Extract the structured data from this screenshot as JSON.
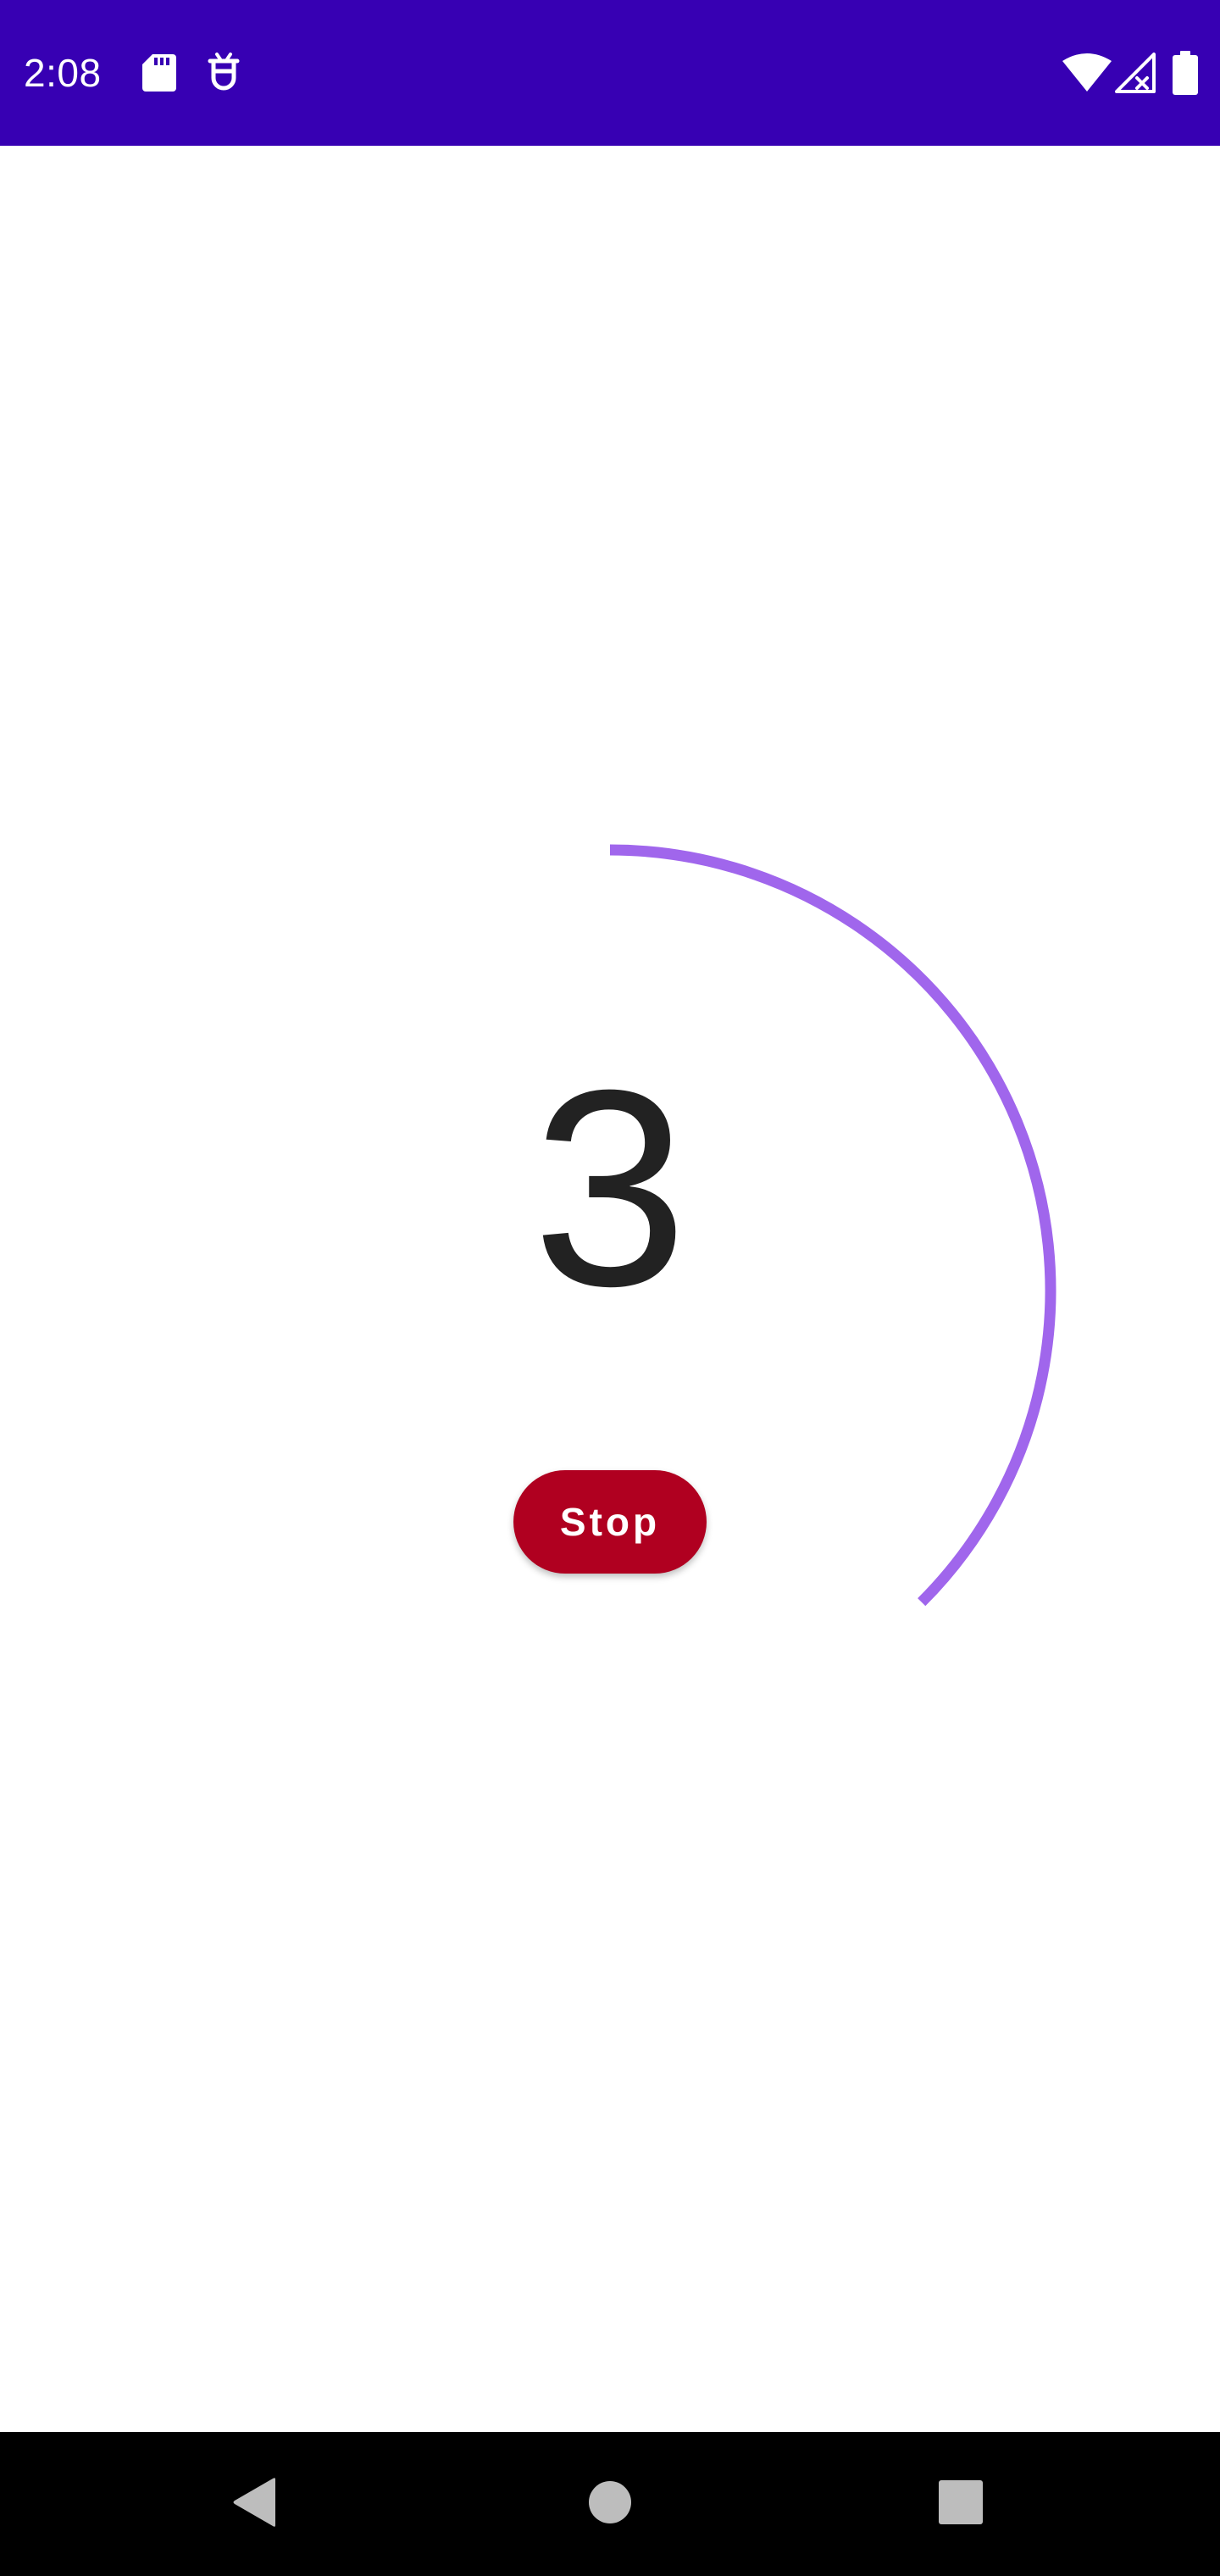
{
  "status_bar": {
    "time": "2:08",
    "background_color": "#3700b3",
    "icons_left": [
      "sd-card-icon",
      "robot-icon"
    ],
    "icons_right": [
      "wifi-icon",
      "cellular-signal-off-icon",
      "battery-icon"
    ]
  },
  "timer": {
    "countdown": "3",
    "progress_color": "#a066ec",
    "stop_label": "Stop",
    "stop_color": "#b00020"
  },
  "nav_bar": {
    "icons": [
      "back-icon",
      "home-icon",
      "recents-icon"
    ]
  }
}
